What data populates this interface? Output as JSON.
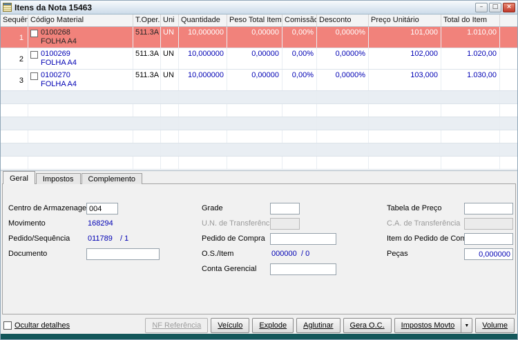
{
  "window": {
    "title": "Itens da Nota 15463",
    "controls": {
      "minimize": "–",
      "maximize": "□",
      "close": "×"
    }
  },
  "grid": {
    "columns": [
      "Sequência",
      "Código Material",
      "T.Oper.",
      "Uni",
      "Quantidade",
      "Peso Total Item",
      "Comissão",
      "Desconto",
      "Preço Unitário",
      "Total do Item"
    ],
    "rows": [
      {
        "seq": "1",
        "code": "0100268",
        "material": "FOLHA A4",
        "toper": "511.3A",
        "uni": "UN",
        "qtd": "10,000000",
        "peso": "0,00000",
        "comissao": "0,00%",
        "desconto": "0,0000%",
        "preco": "101,000",
        "total": "1.010,00",
        "selected": true
      },
      {
        "seq": "2",
        "code": "0100269",
        "material": "FOLHA A4",
        "toper": "511.3A",
        "uni": "UN",
        "qtd": "10,000000",
        "peso": "0,00000",
        "comissao": "0,00%",
        "desconto": "0,0000%",
        "preco": "102,000",
        "total": "1.020,00",
        "selected": false
      },
      {
        "seq": "3",
        "code": "0100270",
        "material": "FOLHA A4",
        "toper": "511.3A",
        "uni": "UN",
        "qtd": "10,000000",
        "peso": "0,00000",
        "comissao": "0,00%",
        "desconto": "0,0000%",
        "preco": "103,000",
        "total": "1.030,00",
        "selected": false
      }
    ]
  },
  "tabs": {
    "items": [
      {
        "label": "Geral",
        "active": true
      },
      {
        "label": "Impostos",
        "active": false
      },
      {
        "label": "Complemento",
        "active": false
      }
    ]
  },
  "form": {
    "centro_armazenagem": {
      "label": "Centro de Armazenagem",
      "value": "004"
    },
    "movimento": {
      "label": "Movimento",
      "value": "168294"
    },
    "pedido_sequencia": {
      "label": "Pedido/Sequência",
      "value": "011789",
      "value2": "/ 1"
    },
    "documento": {
      "label": "Documento",
      "value": ""
    },
    "grade": {
      "label": "Grade",
      "value": ""
    },
    "un_transferencia": {
      "label": "U.N. de Transferência",
      "value": "",
      "disabled": true
    },
    "pedido_compra": {
      "label": "Pedido de Compra",
      "value": ""
    },
    "os_item": {
      "label": "O.S./Item",
      "value": "000000",
      "value2": "/ 0"
    },
    "conta_gerencial": {
      "label": "Conta Gerencial",
      "value": ""
    },
    "tabela_preco": {
      "label": "Tabela de Preço",
      "value": ""
    },
    "ca_transferencia": {
      "label": "C.A. de Transferência",
      "value": "",
      "disabled": true
    },
    "item_pedido_compra": {
      "label": "Item do Pedido de Compra",
      "value": ""
    },
    "pecas": {
      "label": "Peças",
      "value": "0,000000"
    }
  },
  "footer": {
    "ocultar_detalhes_label": "Ocultar detalhes",
    "dropdown_icon": "▼",
    "buttons": [
      {
        "label": "NF Referência",
        "disabled": true
      },
      {
        "label": "Veículo",
        "disabled": false
      },
      {
        "label": "Explode",
        "disabled": false
      },
      {
        "label": "Aglutinar",
        "disabled": false
      },
      {
        "label": "Gera O.C.",
        "disabled": false
      },
      {
        "label": "Impostos Movto",
        "disabled": false,
        "split": true
      },
      {
        "label": "Volume",
        "disabled": false
      }
    ]
  },
  "colors": {
    "selected_row": "#f1827b",
    "value_text": "#0000b4",
    "bottom_strip": "#14575a",
    "titlebar_from": "#f7fafd",
    "titlebar_to": "#ccdbe9"
  }
}
